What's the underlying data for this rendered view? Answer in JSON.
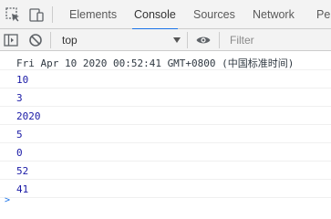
{
  "tabs": [
    {
      "label": "Elements"
    },
    {
      "label": "Console"
    },
    {
      "label": "Sources"
    },
    {
      "label": "Network"
    },
    {
      "label": "Per"
    }
  ],
  "active_tab": "Console",
  "toolbar": {
    "context_label": "top",
    "filter_placeholder": "Filter"
  },
  "console": {
    "messages": [
      {
        "text": "Fri Apr 10 2020 00:52:41 GMT+0800 (中国标准时间)",
        "kind": "string"
      },
      {
        "text": "10",
        "kind": "number"
      },
      {
        "text": "3",
        "kind": "number"
      },
      {
        "text": "2020",
        "kind": "number"
      },
      {
        "text": "5",
        "kind": "number"
      },
      {
        "text": "0",
        "kind": "number"
      },
      {
        "text": "52",
        "kind": "number"
      },
      {
        "text": "41",
        "kind": "number"
      }
    ],
    "prompt": ">"
  },
  "colors": {
    "accent": "#1a73e8",
    "number": "#1a1aa6",
    "text": "#303942",
    "toolbar_bg": "#f3f3f3"
  }
}
